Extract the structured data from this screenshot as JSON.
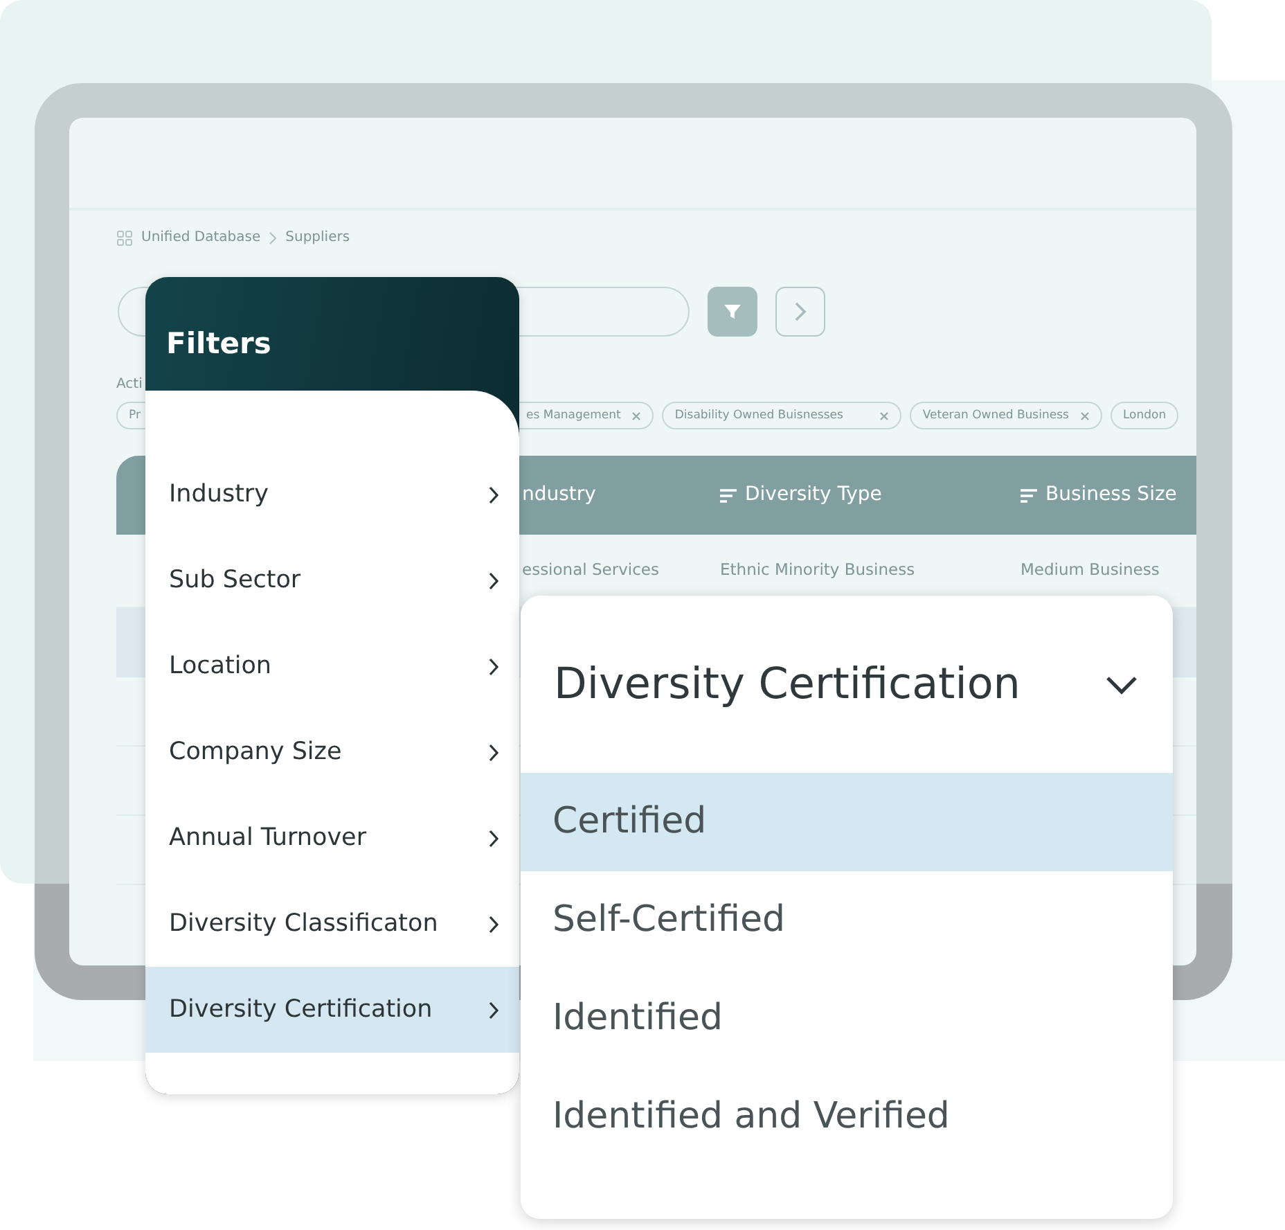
{
  "breadcrumb": [
    {
      "label": "Unified Database"
    },
    {
      "label": "Suppliers"
    }
  ],
  "active_filters": {
    "label": "Acti",
    "chips": [
      {
        "label": "Pr"
      },
      {
        "label": "es Management",
        "removable": true
      },
      {
        "label": "Disability Owned Buisnesses",
        "removable": true
      },
      {
        "label": "Veteran Owned Business",
        "removable": true
      },
      {
        "label": "London"
      }
    ]
  },
  "table": {
    "columns": [
      {
        "label": "ndustry",
        "sortable": false
      },
      {
        "label": "Diversity Type",
        "sortable": true
      },
      {
        "label": "Business Size",
        "sortable": true
      }
    ],
    "rows": [
      [
        "essional Services",
        "Ethnic Minority Business",
        "Medium Business"
      ]
    ]
  },
  "filters": {
    "title": "Filters",
    "items": [
      {
        "label": "Industry",
        "selected": false
      },
      {
        "label": "Sub Sector",
        "selected": false
      },
      {
        "label": "Location",
        "selected": false
      },
      {
        "label": "Company Size",
        "selected": false
      },
      {
        "label": "Annual Turnover",
        "selected": false
      },
      {
        "label": "Diversity Classificaton",
        "selected": false
      },
      {
        "label": "Diversity Certification",
        "selected": true
      }
    ]
  },
  "dropdown": {
    "title": "Diversity Certification",
    "expanded": true,
    "options": [
      {
        "label": "Certified",
        "selected": true
      },
      {
        "label": "Self-Certified",
        "selected": false
      },
      {
        "label": "Identified",
        "selected": false
      },
      {
        "label": "Identified and Verified",
        "selected": false
      }
    ]
  }
}
